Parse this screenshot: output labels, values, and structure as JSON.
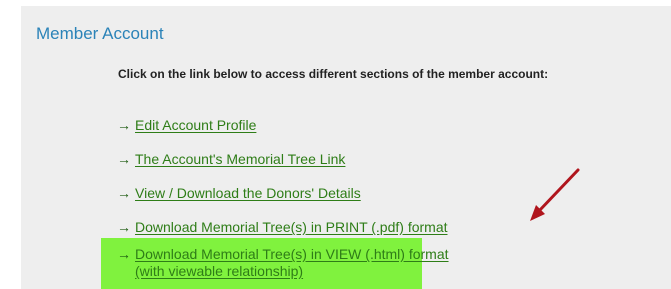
{
  "panel": {
    "title": "Member Account",
    "intro": "Click on the link below to access different sections of the member account:"
  },
  "links": [
    {
      "arrow": "→",
      "label": "Edit Account Profile"
    },
    {
      "arrow": "→",
      "label": "The Account's Memorial Tree Link"
    },
    {
      "arrow": "→",
      "label": "View / Download the Donors' Details"
    },
    {
      "arrow": "→",
      "label": "Download Memorial Tree(s) in PRINT (.pdf) format"
    },
    {
      "arrow": "→",
      "label_line1": "Download Memorial Tree(s) in VIEW (.html) format",
      "label_line2": "(with viewable relationship)"
    }
  ],
  "colors": {
    "panel_bg": "#eeeeee",
    "title": "#2b83b8",
    "link": "#2e7d17",
    "highlight": "#80f23e",
    "pointer_arrow": "#b0151d"
  },
  "icons": {
    "link_arrow": "right-arrow-icon",
    "annotation": "red-pointer-arrow-icon"
  }
}
